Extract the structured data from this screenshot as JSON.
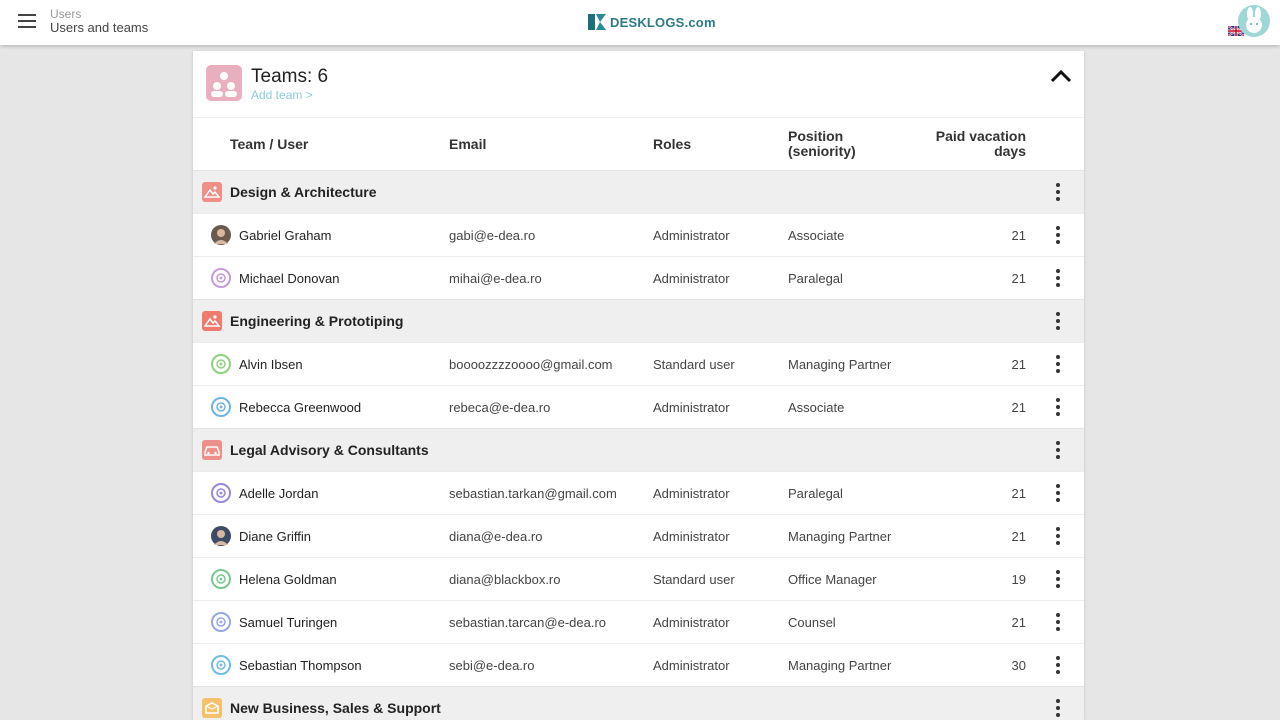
{
  "header": {
    "breadcrumb_parent": "Users",
    "breadcrumb_current": "Users and teams",
    "logo_text": "DESKLOGS",
    "logo_suffix": ".com"
  },
  "panel": {
    "title": "Teams: 6",
    "add_team": "Add team >"
  },
  "columns": {
    "team_user": "Team / User",
    "email": "Email",
    "roles": "Roles",
    "position_1": "Position",
    "position_2": "(seniority)",
    "vacation_1": "Paid vacation",
    "vacation_2": "days"
  },
  "teams": [
    {
      "name": "Design & Architecture",
      "icon": "image-icon",
      "color": "#ef8f88",
      "users": [
        {
          "name": "Gabriel Graham",
          "email": "gabi@e-dea.ro",
          "role": "Administrator",
          "position": "Associate",
          "days": "21",
          "avatar_color": "#6b5a4e",
          "avatar_type": "photo"
        },
        {
          "name": "Michael Donovan",
          "email": "mihai@e-dea.ro",
          "role": "Administrator",
          "position": "Paralegal",
          "days": "21",
          "avatar_color": "#c59ad8",
          "avatar_type": "ring"
        }
      ]
    },
    {
      "name": "Engineering & Prototiping",
      "icon": "image-icon",
      "color": "#ef7b6e",
      "users": [
        {
          "name": "Alvin Ibsen",
          "email": "boooozzzzoooo@gmail.com",
          "role": "Standard user",
          "position": "Managing Partner",
          "days": "21",
          "avatar_color": "#8fd17d",
          "avatar_type": "ring"
        },
        {
          "name": "Rebecca Greenwood",
          "email": "rebeca@e-dea.ro",
          "role": "Administrator",
          "position": "Associate",
          "days": "21",
          "avatar_color": "#6fb4e0",
          "avatar_type": "ring"
        }
      ]
    },
    {
      "name": "Legal Advisory & Consultants",
      "icon": "car-icon",
      "color": "#ef8f8a",
      "users": [
        {
          "name": "Adelle Jordan",
          "email": "sebastian.tarkan@gmail.com",
          "role": "Administrator",
          "position": "Paralegal",
          "days": "21",
          "avatar_color": "#9a86e0",
          "avatar_type": "ring"
        },
        {
          "name": "Diane Griffin",
          "email": "diana@e-dea.ro",
          "role": "Administrator",
          "position": "Managing Partner",
          "days": "21",
          "avatar_color": "#3d4c66",
          "avatar_type": "photo"
        },
        {
          "name": "Helena Goldman",
          "email": "diana@blackbox.ro",
          "role": "Standard user",
          "position": "Office Manager",
          "days": "19",
          "avatar_color": "#78c98d",
          "avatar_type": "ring"
        },
        {
          "name": "Samuel Turingen",
          "email": "sebastian.tarcan@e-dea.ro",
          "role": "Administrator",
          "position": "Counsel",
          "days": "21",
          "avatar_color": "#97a6ea",
          "avatar_type": "ring"
        },
        {
          "name": "Sebastian Thompson",
          "email": "sebi@e-dea.ro",
          "role": "Administrator",
          "position": "Managing Partner",
          "days": "30",
          "avatar_color": "#6fbde0",
          "avatar_type": "ring"
        }
      ]
    },
    {
      "name": "New Business, Sales & Support",
      "icon": "box-icon",
      "color": "#f5c16a",
      "users": []
    }
  ]
}
